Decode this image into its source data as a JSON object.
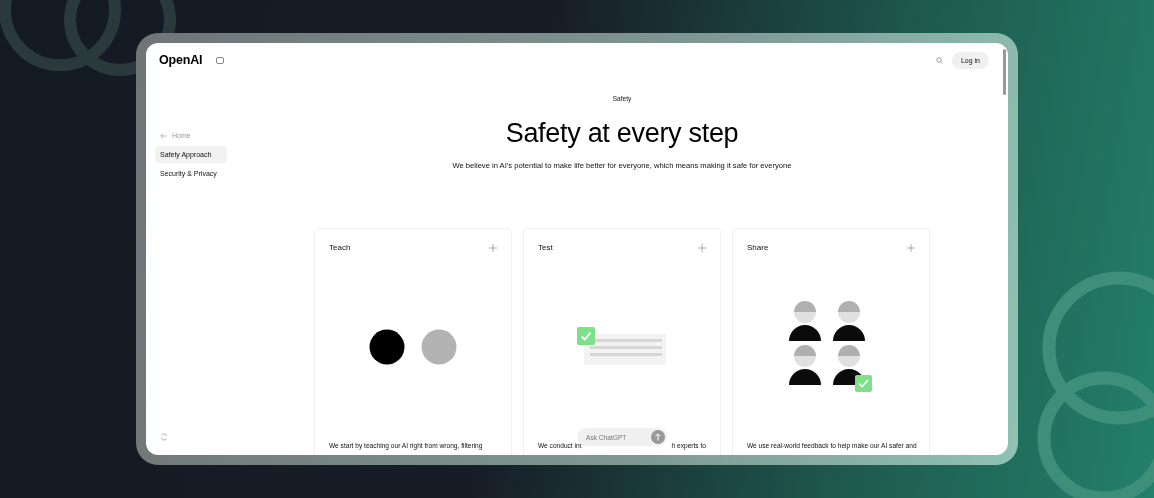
{
  "header": {
    "logo": "OpenAI",
    "login_button": "Log in"
  },
  "sidebar": {
    "back_link": "Home",
    "items": [
      {
        "label": "Safety Approach",
        "selected": true
      },
      {
        "label": "Security & Privacy",
        "selected": false
      }
    ]
  },
  "hero": {
    "eyebrow": "Safety",
    "title": "Safety at every step",
    "subtitle": "We believe in AI’s potential to make life better for everyone, which means making it safe for everyone"
  },
  "cards": [
    {
      "title": "Teach",
      "kind": "circles",
      "text_parts": [
        "We start by teaching our AI right from wrong, filtering"
      ]
    },
    {
      "title": "Test",
      "kind": "checklist",
      "text_parts": [
        "We conduct int",
        "h experts to"
      ]
    },
    {
      "title": "Share",
      "kind": "people",
      "text_parts": [
        "We use real-world feedback to help make our AI safer and"
      ]
    }
  ],
  "chat_prompt": {
    "placeholder": "Ask ChatGPT"
  }
}
